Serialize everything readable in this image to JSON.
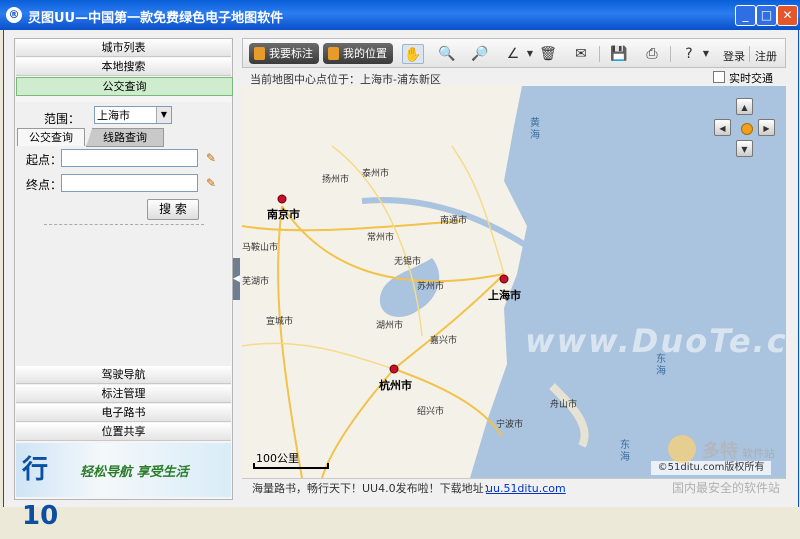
{
  "window": {
    "title": "灵图UU—中国第一款免费绿色电子地图软件",
    "app_icon_glyph": "®",
    "minimize_glyph": "_",
    "maximize_glyph": "□",
    "close_glyph": "✕"
  },
  "left_panel": {
    "menu_top": [
      "城市列表",
      "本地搜索",
      "公交查询"
    ],
    "menu_bottom": [
      "驾驶导航",
      "标注管理",
      "电子路书",
      "位置共享"
    ],
    "range_label": "范围：",
    "range_value": "上海市",
    "tabs": [
      "公交查询",
      "线路查询"
    ],
    "start_label": "起点：",
    "end_label": "终点：",
    "search_button": "搜 索",
    "banner_logo": "行 10",
    "banner_slogan": "轻松导航 享受生活"
  },
  "toolbar": {
    "mark_button": "我要标注",
    "location_button": "我的位置",
    "tools": [
      "pan-hand-icon",
      "zoom-in-icon",
      "zoom-out-icon",
      "measure-icon",
      "delete-icon",
      "mail-icon",
      "save-icon",
      "print-icon",
      "help-icon"
    ],
    "login": "登录",
    "register": "注册"
  },
  "map_header": {
    "center_text": "当前地图中心点位于：上海市-浦东新区",
    "traffic_label": "实时交通"
  },
  "map": {
    "cities_big": [
      "南京市",
      "上海市",
      "杭州市"
    ],
    "cities": [
      "扬州市",
      "泰州市",
      "南通市",
      "常州市",
      "无锡市",
      "苏州市",
      "湖州市",
      "嘉兴市",
      "宣城市",
      "马鞍山市",
      "芜湖市",
      "绍兴市",
      "宁波市",
      "舟山市"
    ],
    "sea_labels": [
      "黄海",
      "东海",
      "东海"
    ],
    "scale": "100公里",
    "copyright": "©51ditu.com版权所有",
    "watermark": "www.DuoTe.com"
  },
  "status": {
    "text": "海量路书，畅行天下！UU4.0发布啦！下载地址：",
    "link": "uu.51ditu.com"
  },
  "site_watermark": {
    "brand": "多特",
    "brand_small": "软件站",
    "tagline": "国内最安全的软件站"
  },
  "colors": {
    "titlebar": "#0a5fd8",
    "active_menu": "#cfeccf",
    "map_sea": "#aac3df",
    "map_land": "#f4f2e8",
    "road_major": "#f2c24a"
  }
}
